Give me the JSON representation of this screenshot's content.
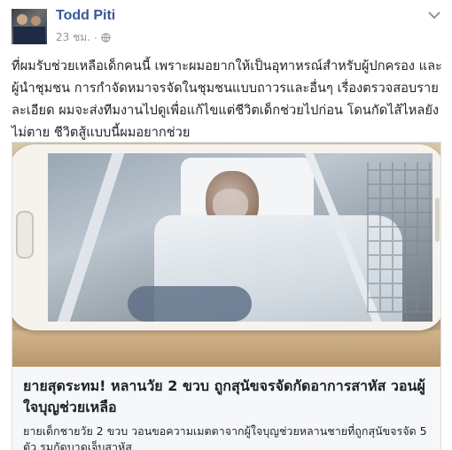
{
  "post": {
    "author": "Todd Piti",
    "time": "23 ชม.",
    "separator": "·",
    "privacy_icon": "globe-icon",
    "menu_icon": "chevron-down-icon",
    "text": "ที่ผมรับช่วยเหลือเด็กคนนี้ เพราะผมอยากให้เป็นอุทาหรณ์สำหรับผู้ปกครอง และผู้นำชุมชน การกำจัดหมาจรจัดในชุมชนแบบถาวรและอื่นๆ เรื่องตรวจสอบรายละเอียด ผมจะส่งทีมงานไปดูเพื่อแก้ไขแต่ชีวิตเด็กช่วยไปก่อน โดนกัดไส้ไหลยังไม่ตาย ชีวิตสู้แบบนี้ผมอยากช่วย"
  },
  "link_card": {
    "title": "ยายสุดระทม! หลานวัย 2 ขวบ ถูกสุนัขจรจัดกัดอาการสาหัส วอนผู้ใจบุญช่วยเหลือ",
    "description": "ยายเด็กชายวัย 2 ขวบ วอนขอความเมตตาจากผู้ใจบุญช่วยหลานชายที่ถูกสุนัขจรจัด 5 ตัว รุมกัดบาดเจ็บสาหัส"
  },
  "colors": {
    "author_link": "#365899",
    "meta_gray": "#90949c",
    "card_bg": "#f6f7f9",
    "border": "#dddfe2"
  }
}
